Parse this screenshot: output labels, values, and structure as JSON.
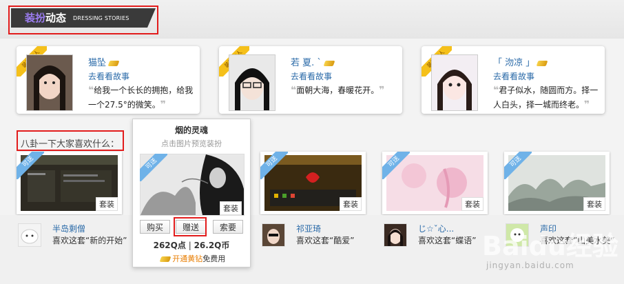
{
  "header": {
    "title_colored": "装扮",
    "title_white": "动态",
    "subtitle": "DRESSING STORIES"
  },
  "badges": {
    "dress_master": "装扮达人",
    "can_send": "可送",
    "set": "套装"
  },
  "stories": [
    {
      "name": "猫坠",
      "link": "去看看故事",
      "quote": "给我一个长长的拥抱，给我一个27.5°的微笑。"
    },
    {
      "name": "若 夏. `",
      "link": "去看看故事",
      "quote": "面朝大海，春暖花开。"
    },
    {
      "name": "「 沕凉 」",
      "link": "去看看故事",
      "quote": "君子似水，随圆而方。择一人白头，择一城而终老。"
    }
  ],
  "gossip_label": "八卦一下大家喜欢什么：",
  "popup": {
    "title": "烟的灵魂",
    "subtitle": "点击图片预览装扮",
    "buy_label": "购买",
    "gift_label": "赠送",
    "request_label": "索要",
    "points": "262Q点",
    "separator": "|",
    "coins": "26.2Q币",
    "vip_link": "开通黄钻",
    "vip_suffix": "免费用"
  },
  "users": [
    {
      "name": "半岛剩僧",
      "liked": "喜欢这套“新的开始”"
    },
    {
      "name": "祁亚琦",
      "liked": "喜欢这套“酷爱”"
    },
    {
      "name": "じ☆ˇ心...",
      "liked": "喜欢这套“蝶语”"
    },
    {
      "name": "声印",
      "liked": "喜欢这套“山美水美”"
    }
  ],
  "watermark": {
    "brand": "Baidu经验",
    "url": "jingyan.baidu.com"
  },
  "colors": {
    "accent_purple": "#9b7cf0",
    "link_blue": "#2a6aa8",
    "highlight_red": "#e21b1b",
    "ribbon_yellow": "#f5c01a",
    "send_blue": "#6fb2e8"
  }
}
